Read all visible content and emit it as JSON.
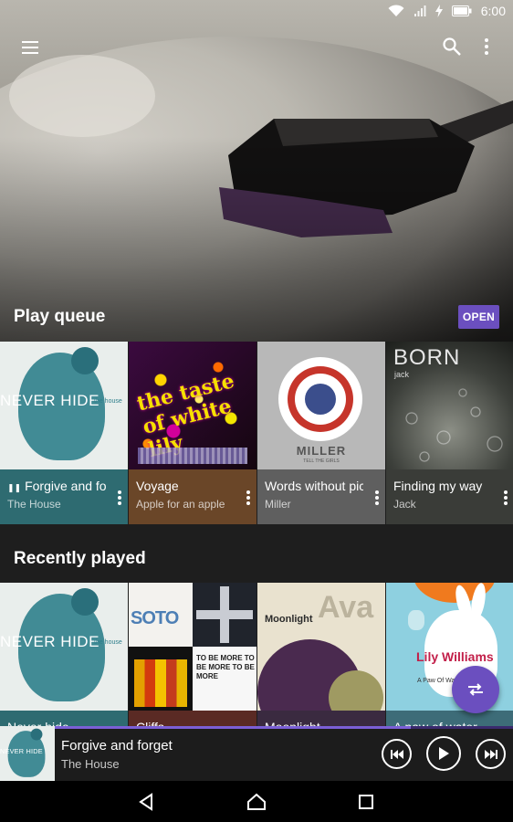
{
  "status_bar": {
    "time": "6:00",
    "icons": [
      "wifi-icon",
      "signal-icon",
      "charging-icon",
      "battery-icon"
    ]
  },
  "app_bar": {
    "icons": [
      "menu-icon",
      "search-icon",
      "overflow-icon"
    ]
  },
  "play_queue": {
    "title": "Play queue",
    "open_label": "OPEN",
    "items": [
      {
        "title": "Forgive and forget",
        "subtitle": "The House",
        "playing": true,
        "pause_glyph": "❚❚",
        "footer_color": "#2e6b71",
        "art": {
          "text": "NEVER HIDE",
          "small": "the house"
        }
      },
      {
        "title": "Voyage",
        "subtitle": "Apple for an apple",
        "playing": false,
        "footer_color": "#6a4628",
        "art": {
          "text": "the taste of white lily",
          "small": ""
        }
      },
      {
        "title": "Words without pictures",
        "subtitle": "Miller",
        "playing": false,
        "footer_color": "#5f5f5f",
        "art": {
          "text": "MILLER",
          "small": "TELL THE GIRLS"
        }
      },
      {
        "title": "Finding my way",
        "subtitle": "Jack",
        "playing": false,
        "footer_color": "#3a3c38",
        "art": {
          "text": "BORN",
          "small": "jack"
        }
      }
    ]
  },
  "recently_played": {
    "title": "Recently played",
    "items": [
      {
        "title": "Never hide",
        "art": {
          "text": "NEVER HIDE",
          "small": "the house"
        }
      },
      {
        "title": "Cliffs",
        "art": {
          "text": "SOTO",
          "small": "TO BE MORE TO BE MORE TO BE MORE"
        }
      },
      {
        "title": "Moonlight",
        "art": {
          "text": "Ava",
          "small": "Moonlight"
        }
      },
      {
        "title": "A paw of water",
        "art": {
          "text": "Lily Williams",
          "small": "A Paw Of Water"
        }
      }
    ]
  },
  "fab": {
    "icon": "shuffle-repeat-icon"
  },
  "now_playing": {
    "title": "Forgive and forget",
    "artist": "The House",
    "progress": 0.8,
    "controls": [
      "previous-icon",
      "play-icon",
      "next-icon"
    ]
  },
  "nav_bar": {
    "icons": [
      "back-icon",
      "home-icon",
      "recents-icon"
    ]
  },
  "colors": {
    "accent": "#6b4fbf",
    "background": "#1e1e1e"
  }
}
